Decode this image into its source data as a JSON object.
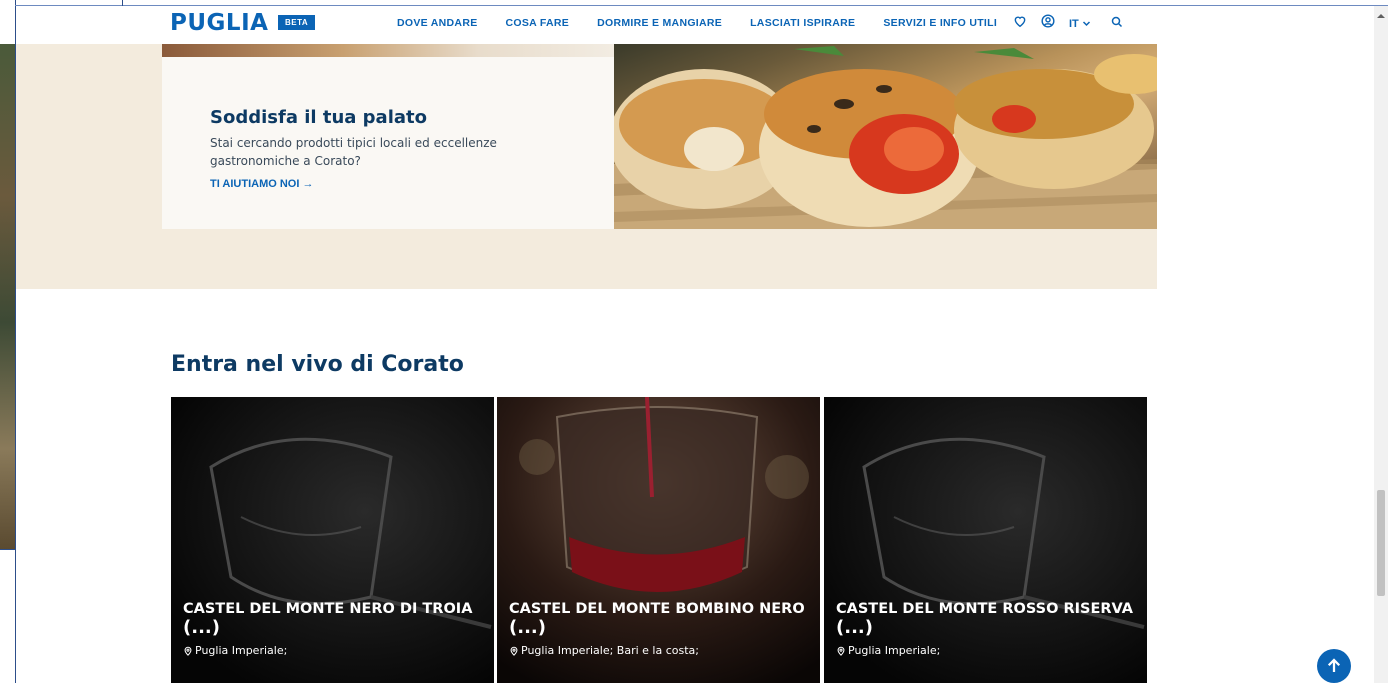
{
  "header": {
    "logo": "PUGLIA",
    "badge": "BETA",
    "nav": [
      "DOVE ANDARE",
      "COSA FARE",
      "DORMIRE E MANGIARE",
      "LASCIATI ISPIRARE",
      "SERVIZI E INFO UTILI"
    ],
    "language": "IT",
    "icons": [
      "heart-icon",
      "user-circle-icon",
      "chevron-down-icon",
      "search-icon"
    ]
  },
  "promo": {
    "title": "Soddisfa il tua palato",
    "text": "Stai cercando prodotti tipici locali ed eccellenze gastronomiche a Corato?",
    "link": "TI AIUTIAMO NOI →"
  },
  "section": {
    "title": "Entra nel vivo di Corato",
    "cards": [
      {
        "title": "CASTEL DEL MONTE NERO DI TROIA",
        "ellipsis": "(...)",
        "location": "Puglia Imperiale;"
      },
      {
        "title": "CASTEL DEL MONTE BOMBINO NERO",
        "ellipsis": "(...)",
        "location": "Puglia Imperiale; Bari e la costa;"
      },
      {
        "title": "CASTEL DEL MONTE ROSSO RISERVA",
        "ellipsis": "(...)",
        "location": "Puglia Imperiale;"
      }
    ]
  },
  "colors": {
    "brand": "#0b64b5",
    "heading": "#0d3a63",
    "beige": "#f3ebdd"
  }
}
